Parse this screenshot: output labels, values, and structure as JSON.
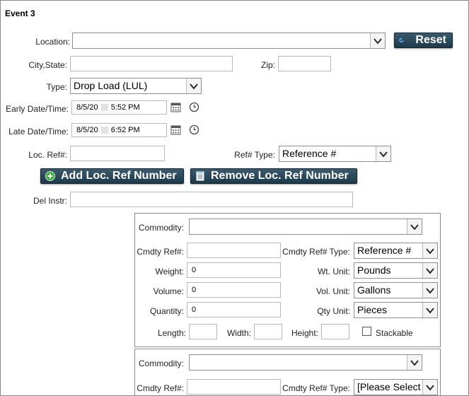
{
  "event": {
    "title": "Event 3"
  },
  "location": {
    "label": "Location:",
    "value": ""
  },
  "reset_label": "Reset",
  "city_state": {
    "label": "City,State:",
    "value": ""
  },
  "zip": {
    "label": "Zip:",
    "value": ""
  },
  "type": {
    "label": "Type:",
    "value": "Drop Load (LUL)"
  },
  "early_datetime": {
    "label": "Early Date/Time:",
    "date": "8/5/20",
    "time": "5:52 PM"
  },
  "late_datetime": {
    "label": "Late Date/Time:",
    "date": "8/5/20",
    "time": "6:52 PM"
  },
  "loc_ref": {
    "label": "Loc. Ref#:",
    "value": ""
  },
  "ref_type": {
    "label": "Ref# Type:",
    "value": "Reference #"
  },
  "add_loc_ref_label": "Add Loc. Ref Number",
  "remove_loc_ref_label": "Remove Loc. Ref Number",
  "del_instr": {
    "label": "Del Instr:",
    "value": ""
  },
  "commodity_1": {
    "commodity_label": "Commodity:",
    "commodity_value": "",
    "cmdty_ref_label": "Cmdty Ref#:",
    "cmdty_ref_value": "",
    "cmdty_ref_type_label": "Cmdty Ref# Type:",
    "cmdty_ref_type_value": "Reference #",
    "weight_label": "Weight:",
    "weight_value": "0",
    "wt_unit_label": "Wt. Unit:",
    "wt_unit_value": "Pounds",
    "volume_label": "Volume:",
    "volume_value": "0",
    "vol_unit_label": "Vol. Unit:",
    "vol_unit_value": "Gallons",
    "quantity_label": "Quantity:",
    "quantity_value": "0",
    "qty_unit_label": "Qty Unit:",
    "qty_unit_value": "Pieces",
    "length_label": "Length:",
    "width_label": "Width:",
    "height_label": "Height:",
    "stackable_label": "Stackable",
    "stackable_checked": false
  },
  "commodity_2": {
    "commodity_label": "Commodity:",
    "commodity_value": "",
    "cmdty_ref_label": "Cmdty Ref#:",
    "cmdty_ref_value": "",
    "cmdty_ref_type_label": "Cmdty Ref# Type:",
    "cmdty_ref_type_value": "[Please Select"
  },
  "icons": [
    "chevron-down-icon",
    "refresh-icon",
    "calendar-icon",
    "clock-icon",
    "plus-icon",
    "trash-icon"
  ],
  "colors": {
    "button_bg": "#1d3a4c",
    "border": "#b9b9b9",
    "text": "#222222"
  }
}
